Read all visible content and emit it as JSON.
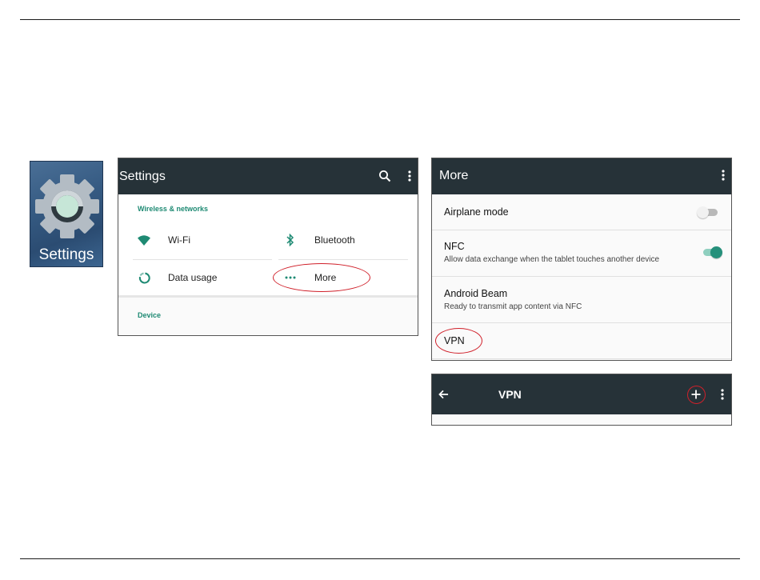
{
  "colors": {
    "appbar": "#263238",
    "accent": "#1e8a73",
    "switch_on_track": "#8fcfbf",
    "switch_on_thumb": "#26907b",
    "switch_off_track": "#b9b9b9",
    "switch_off_thumb": "#f1f1f1",
    "annotation": "#d0202a"
  },
  "app_icon": {
    "label": "Settings",
    "icon": "gear-icon"
  },
  "settings_screen": {
    "title": "Settings",
    "icons": [
      "search-icon",
      "more-vert-icon"
    ],
    "sections": [
      {
        "header": "Wireless & networks",
        "items": [
          {
            "label": "Wi-Fi",
            "icon": "wifi-icon"
          },
          {
            "label": "Bluetooth",
            "icon": "bluetooth-icon"
          },
          {
            "label": "Data usage",
            "icon": "data-usage-icon"
          },
          {
            "label": "More",
            "icon": "more-horiz-icon"
          }
        ]
      },
      {
        "header": "Device",
        "items": []
      }
    ]
  },
  "more_screen": {
    "title": "More",
    "icons": [
      "more-vert-icon"
    ],
    "rows": [
      {
        "title": "Airplane mode",
        "subtitle": "",
        "toggle": false
      },
      {
        "title": "NFC",
        "subtitle": "Allow data exchange when the tablet touches another device",
        "toggle": true
      },
      {
        "title": "Android Beam",
        "subtitle": "Ready to transmit app content via NFC"
      },
      {
        "title": "VPN",
        "subtitle": ""
      }
    ]
  },
  "vpn_screen": {
    "title": "VPN",
    "icons": [
      "back-arrow-icon",
      "add-icon",
      "more-vert-icon"
    ]
  }
}
